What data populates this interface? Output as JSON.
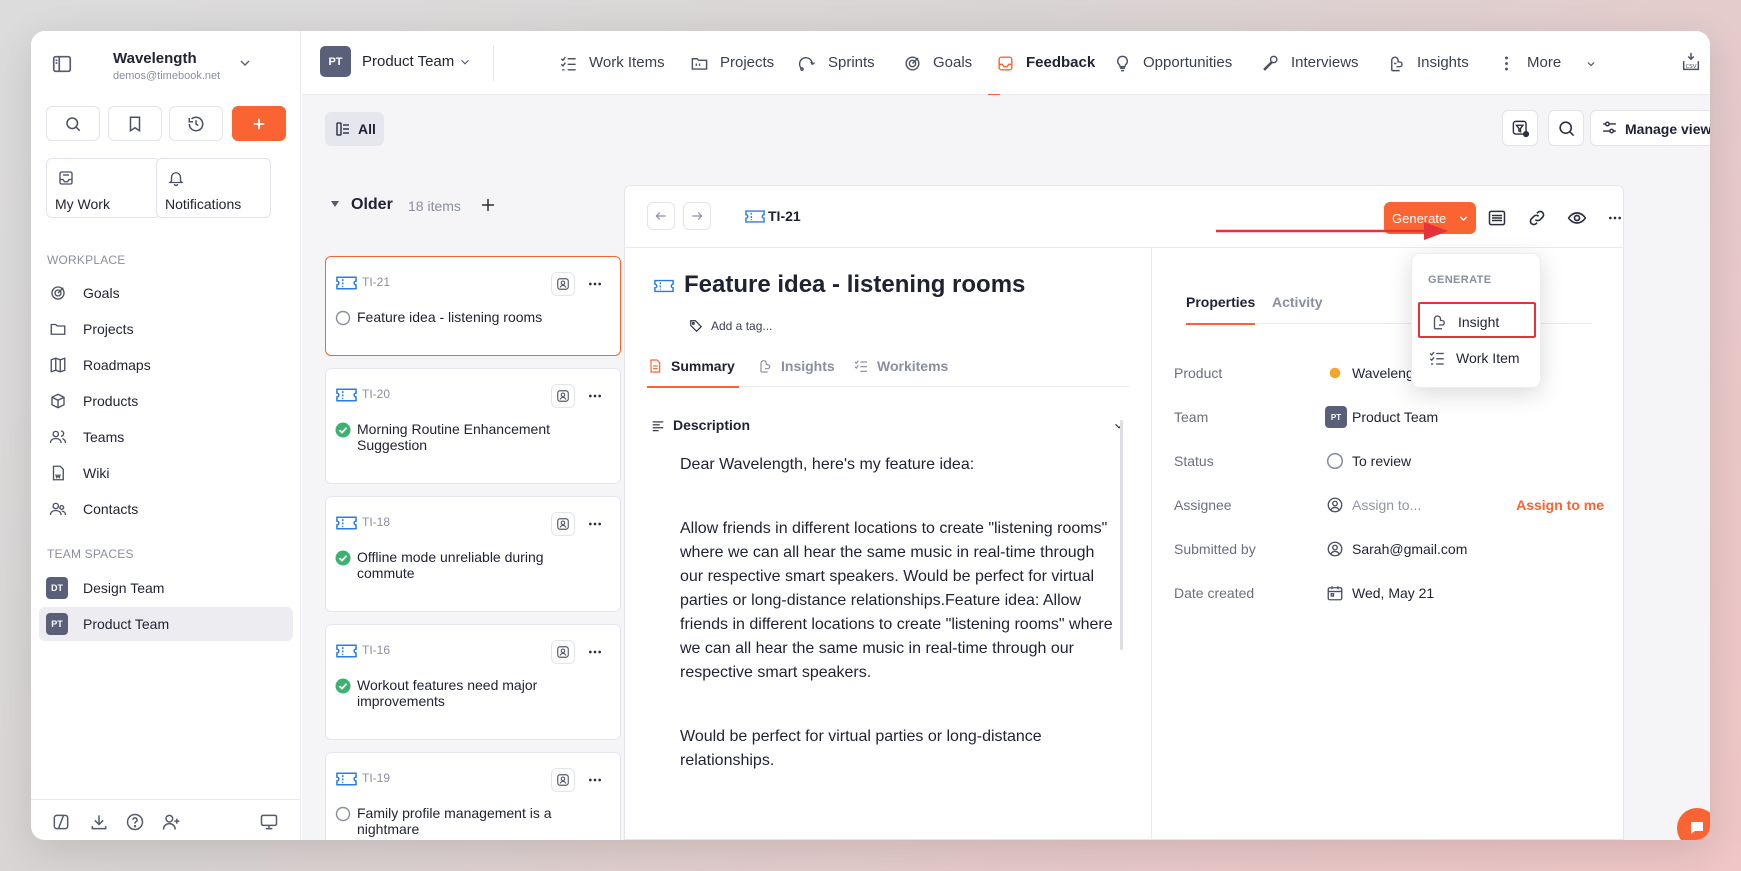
{
  "workspace": {
    "name": "Wavelength",
    "email": "demos@timebook.net"
  },
  "sidebar": {
    "my_work": "My Work",
    "notifications": "Notifications",
    "workplace_label": "WORKPLACE",
    "workplace_items": [
      {
        "label": "Goals",
        "icon": "goals-icon"
      },
      {
        "label": "Projects",
        "icon": "folder-icon"
      },
      {
        "label": "Roadmaps",
        "icon": "map-icon"
      },
      {
        "label": "Products",
        "icon": "cube-icon"
      },
      {
        "label": "Teams",
        "icon": "users-icon"
      },
      {
        "label": "Wiki",
        "icon": "doc-icon"
      },
      {
        "label": "Contacts",
        "icon": "contacts-icon"
      }
    ],
    "team_spaces_label": "TEAM SPACES",
    "team_spaces": [
      {
        "badge": "DT",
        "label": "Design Team"
      },
      {
        "badge": "PT",
        "label": "Product Team"
      }
    ]
  },
  "topnav": {
    "team": {
      "badge": "PT",
      "label": "Product Team"
    },
    "tabs": [
      {
        "label": "Work Items"
      },
      {
        "label": "Projects"
      },
      {
        "label": "Sprints"
      },
      {
        "label": "Goals"
      },
      {
        "label": "Feedback"
      },
      {
        "label": "Opportunities"
      },
      {
        "label": "Interviews"
      },
      {
        "label": "Insights"
      },
      {
        "label": "More"
      }
    ],
    "active_tab": "Feedback"
  },
  "toolbar": {
    "all_label": "All",
    "manage_view": "Manage view"
  },
  "list": {
    "group_name": "Older",
    "group_count": "18 items",
    "items": [
      {
        "id": "TI-21",
        "title": "Feature idea - listening rooms",
        "status": "open"
      },
      {
        "id": "TI-20",
        "title": "Morning Routine Enhancement Suggestion",
        "status": "done"
      },
      {
        "id": "TI-18",
        "title": "Offline mode unreliable during commute",
        "status": "done"
      },
      {
        "id": "TI-16",
        "title": "Workout features need major improvements",
        "status": "done"
      },
      {
        "id": "TI-19",
        "title": "Family profile management is a nightmare",
        "status": "open"
      }
    ]
  },
  "detail": {
    "id": "TI-21",
    "generate_label": "Generate",
    "title": "Feature idea - listening rooms",
    "add_tag": "Add a tag...",
    "subtabs": [
      "Summary",
      "Insights",
      "Workitems"
    ],
    "description_label": "Description",
    "description": [
      "Dear Wavelength, here's my feature idea:",
      "Allow friends in different locations to create \"listening rooms\" where we can all hear the same music in real-time through our respective smart speakers. Would be perfect for virtual parties or long-distance relationships.Feature idea: Allow friends in different locations to create \"listening rooms\" where we can all hear the same music in real-time through our respective smart speakers.",
      "Would be perfect for virtual parties or long-distance relationships."
    ],
    "right_tabs": [
      "Properties",
      "Activity"
    ],
    "properties": {
      "product_label": "Product",
      "product_value": "Wavelength",
      "team_label": "Team",
      "team_badge": "PT",
      "team_value": "Product Team",
      "status_label": "Status",
      "status_value": "To review",
      "assignee_label": "Assignee",
      "assignee_value": "Assign to...",
      "assign_me": "Assign to me",
      "submitted_label": "Submitted by",
      "submitted_value": "Sarah@gmail.com",
      "date_label": "Date created",
      "date_value": "Wed, May 21"
    }
  },
  "dropdown": {
    "header": "GENERATE",
    "items": [
      {
        "label": "Insight"
      },
      {
        "label": "Work Item"
      }
    ]
  },
  "colors": {
    "accent": "#f96432",
    "highlight": "#e5323b",
    "ticket_blue": "#2d7be0",
    "done_green": "#3bb273"
  }
}
